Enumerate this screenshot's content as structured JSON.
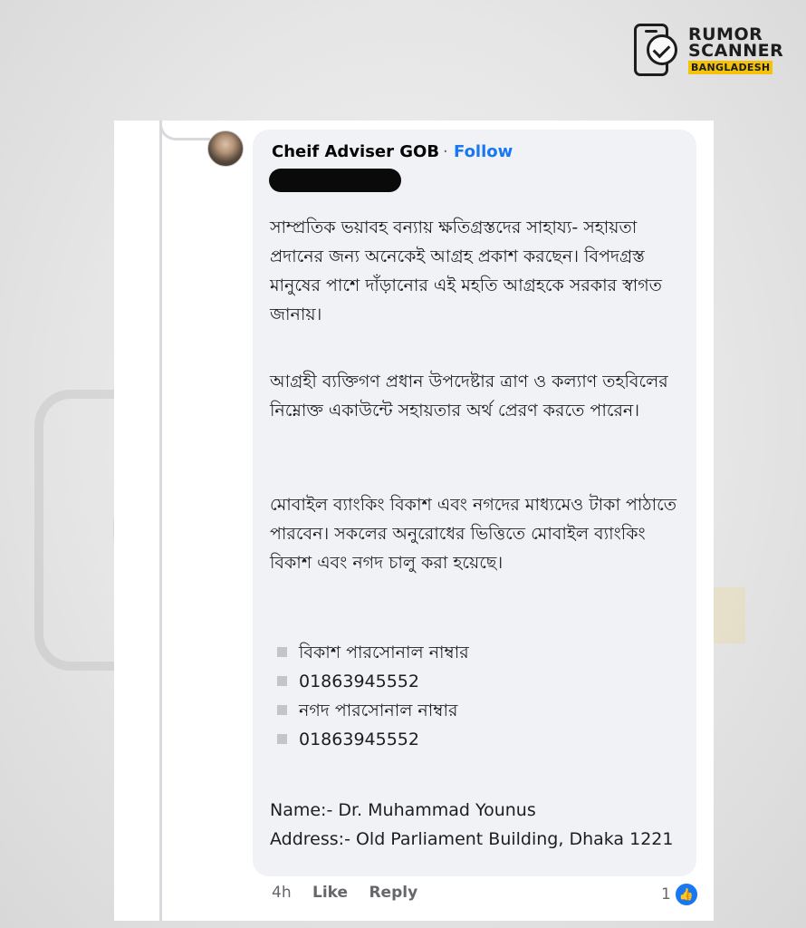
{
  "logo": {
    "line1": "RUMOR",
    "line2": "SCANNER",
    "line3": "BANGLADESH"
  },
  "watermark": {
    "line1": "RUMOR",
    "line2": "SCANNER",
    "line3": "BANGLADESH"
  },
  "comment": {
    "author": "Cheif Adviser GOB",
    "separator": "·",
    "follow_label": "Follow",
    "paragraphs": [
      "সাম্প্রতিক ভয়াবহ বন্যায় ক্ষতিগ্রস্তদের সাহায্য- সহায়তা প্রদানের জন্য অনেকেই আগ্রহ প্রকাশ করছেন। বিপদগ্রস্ত মানুষের পাশে দাঁড়ানোর এই মহতি আগ্রহকে সরকার স্বাগত জানায়।",
      "আগ্রহী ব্যক্তিগণ প্রধান উপদেষ্টার ত্রাণ ও কল্যাণ তহবিলের নিম্নোক্ত একাউন্টে সহায়তার অর্থ প্রেরণ করতে পারেন।",
      "মোবাইল ব্যাংকিং বিকাশ এবং নগদের মাধ্যমেও টাকা পাঠাতে পারবেন। সকলের অনুরোধের ভিত্তিতে মোবাইল ব্যাংকিং  বিকাশ এবং নগদ চালু করা হয়েছে।"
    ],
    "list": [
      "বিকাশ পারসোনাল নাম্বার",
      "01863945552",
      "নগদ পারসোনাল নাম্বার",
      "01863945552"
    ],
    "name_line": "Name:- Dr. Muhammad Younus",
    "address_line": "Address:- Old Parliament Building, Dhaka 1221",
    "time": "4h",
    "like_label": "Like",
    "reply_label": "Reply",
    "reaction_count": "1"
  }
}
